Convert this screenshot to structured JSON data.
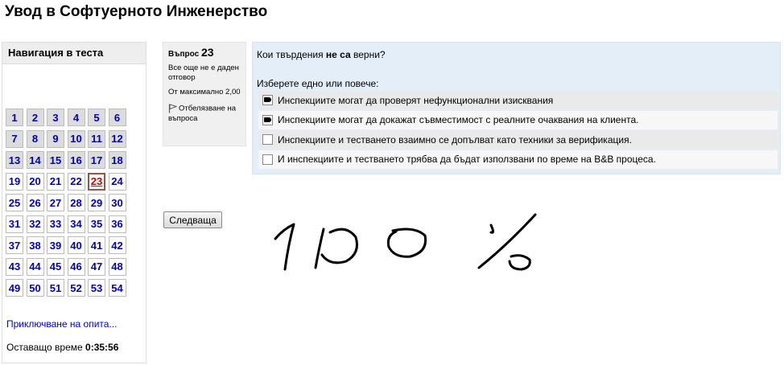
{
  "page": {
    "title": "Увод в Софтуерното Инженерство"
  },
  "navigation": {
    "header": "Навигация в теста",
    "questions": [
      {
        "label": "1",
        "state": "answered"
      },
      {
        "label": "2",
        "state": "answered"
      },
      {
        "label": "3",
        "state": "answered"
      },
      {
        "label": "4",
        "state": "answered"
      },
      {
        "label": "5",
        "state": "answered"
      },
      {
        "label": "6",
        "state": "answered"
      },
      {
        "label": "7",
        "state": "answered"
      },
      {
        "label": "8",
        "state": "answered"
      },
      {
        "label": "9",
        "state": "answered"
      },
      {
        "label": "10",
        "state": "answered"
      },
      {
        "label": "11",
        "state": "answered"
      },
      {
        "label": "12",
        "state": "answered"
      },
      {
        "label": "13",
        "state": "answered"
      },
      {
        "label": "14",
        "state": "answered"
      },
      {
        "label": "15",
        "state": "answered"
      },
      {
        "label": "16",
        "state": "answered"
      },
      {
        "label": "17",
        "state": "answered"
      },
      {
        "label": "18",
        "state": "answered"
      },
      {
        "label": "19",
        "state": "unanswered"
      },
      {
        "label": "20",
        "state": "unanswered"
      },
      {
        "label": "21",
        "state": "unanswered"
      },
      {
        "label": "22",
        "state": "unanswered"
      },
      {
        "label": "23",
        "state": "current"
      },
      {
        "label": "24",
        "state": "unanswered"
      },
      {
        "label": "25",
        "state": "unanswered"
      },
      {
        "label": "26",
        "state": "unanswered"
      },
      {
        "label": "27",
        "state": "unanswered"
      },
      {
        "label": "28",
        "state": "unanswered"
      },
      {
        "label": "29",
        "state": "unanswered"
      },
      {
        "label": "30",
        "state": "unanswered"
      },
      {
        "label": "31",
        "state": "unanswered"
      },
      {
        "label": "32",
        "state": "unanswered"
      },
      {
        "label": "33",
        "state": "unanswered"
      },
      {
        "label": "34",
        "state": "unanswered"
      },
      {
        "label": "35",
        "state": "unanswered"
      },
      {
        "label": "36",
        "state": "unanswered"
      },
      {
        "label": "37",
        "state": "unanswered"
      },
      {
        "label": "38",
        "state": "unanswered"
      },
      {
        "label": "39",
        "state": "unanswered"
      },
      {
        "label": "40",
        "state": "unanswered"
      },
      {
        "label": "41",
        "state": "unanswered"
      },
      {
        "label": "42",
        "state": "unanswered"
      },
      {
        "label": "43",
        "state": "unanswered"
      },
      {
        "label": "44",
        "state": "unanswered"
      },
      {
        "label": "45",
        "state": "unanswered"
      },
      {
        "label": "46",
        "state": "unanswered"
      },
      {
        "label": "47",
        "state": "unanswered"
      },
      {
        "label": "48",
        "state": "unanswered"
      },
      {
        "label": "49",
        "state": "unanswered"
      },
      {
        "label": "50",
        "state": "unanswered"
      },
      {
        "label": "51",
        "state": "unanswered"
      },
      {
        "label": "52",
        "state": "unanswered"
      },
      {
        "label": "53",
        "state": "unanswered"
      },
      {
        "label": "54",
        "state": "unanswered"
      }
    ],
    "finish_link": "Приключване на опита...",
    "time_label": "Оставащо време",
    "time_value": "0:35:56"
  },
  "question_info": {
    "label": "Въпрос",
    "number": "23",
    "state": "Все още не е даден отговор",
    "grade": "От максимално 2,00",
    "flag_label": "Отбелязване на въпроса",
    "flag_icon": "flag-icon"
  },
  "question": {
    "text_before": "Кои твърдения ",
    "text_emph": "не са",
    "text_after": " верни?",
    "prompt": "Изберете едно или повече:",
    "answers": [
      {
        "text": "Инспекциите могат да проверят нефункционални изисквания",
        "checked": true
      },
      {
        "text": "Инспекциите могат да докажат съвместимост с реалните очаквания на клиента.",
        "checked": true
      },
      {
        "text": "Инспекциите и тестването взаимно се допълват като техники за верификация.",
        "checked": false
      },
      {
        "text": "И инспекциите и тестването трябва да бъдат използвани по време на В&В процеса.",
        "checked": false
      }
    ]
  },
  "next_button": "Следваща",
  "annotation": {
    "text": "100 %"
  }
}
